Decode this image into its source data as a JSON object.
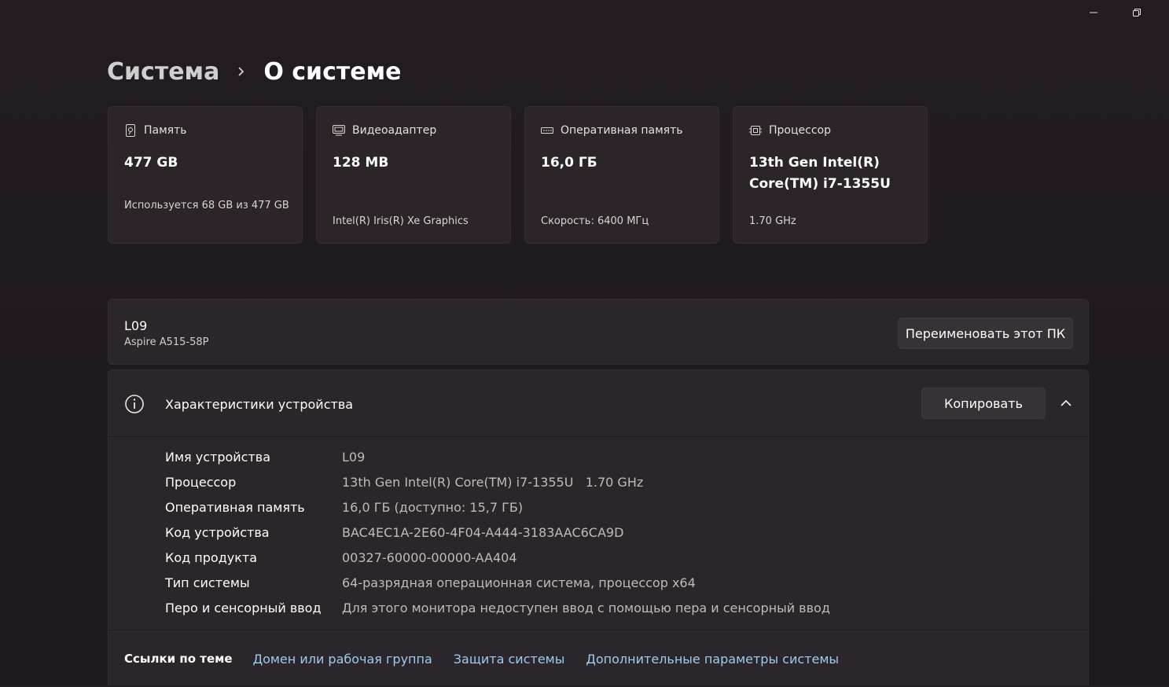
{
  "breadcrumb": {
    "parent": "Система",
    "current": "О системе"
  },
  "cards": [
    {
      "icon": "storage-icon",
      "title": "Память",
      "value": "477 GB",
      "sub": "Используется 68 GB из 477 GB"
    },
    {
      "icon": "monitor-icon",
      "title": "Видеоадаптер",
      "value": "128 MB",
      "sub": "Intel(R) Iris(R) Xe Graphics"
    },
    {
      "icon": "ram-icon",
      "title": "Оперативная память",
      "value": "16,0 ГБ",
      "sub": "Скорость: 6400 МГц"
    },
    {
      "icon": "cpu-icon",
      "title": "Процессор",
      "value": "13th Gen Intel(R) Core(TM) i7-1355U",
      "sub": "1.70 GHz"
    }
  ],
  "device": {
    "name": "L09",
    "model": "Aspire A515-58P",
    "rename_label": "Переименовать этот ПК"
  },
  "specs": {
    "title": "Характеристики устройства",
    "copy_label": "Копировать",
    "rows": [
      {
        "label": "Имя устройства",
        "value": "L09"
      },
      {
        "label": "Процессор",
        "value": "13th Gen Intel(R) Core(TM) i7-1355U   1.70 GHz"
      },
      {
        "label": "Оперативная память",
        "value": "16,0 ГБ (доступно: 15,7 ГБ)"
      },
      {
        "label": "Код устройства",
        "value": "BAC4EC1A-2E60-4F04-A444-3183AAC6CA9D"
      },
      {
        "label": "Код продукта",
        "value": "00327-60000-00000-AA404"
      },
      {
        "label": "Тип системы",
        "value": "64-разрядная операционная система, процессор x64"
      },
      {
        "label": "Перо и сенсорный ввод",
        "value": "Для этого монитора недоступен ввод с помощью пера и сенсорный ввод"
      }
    ]
  },
  "links": {
    "title": "Ссылки по теме",
    "items": [
      "Домен или рабочая группа",
      "Защита системы",
      "Дополнительные параметры системы"
    ]
  },
  "colors": {
    "accent_link": "#9ecbf0",
    "card_bg": "#2b2529",
    "page_bg": "#221b22"
  }
}
